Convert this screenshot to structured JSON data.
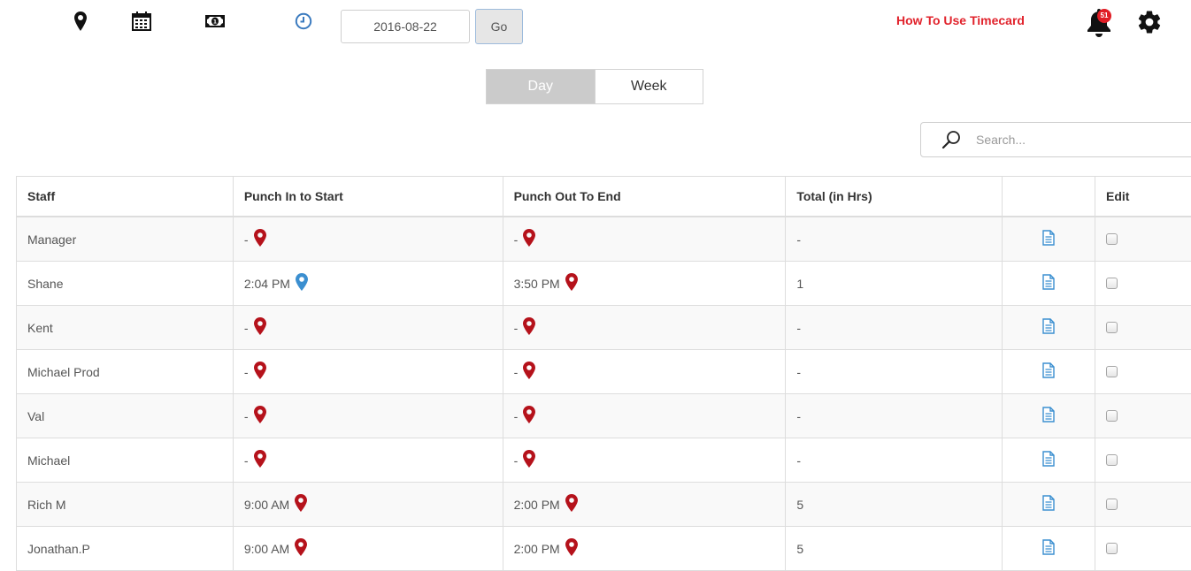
{
  "toolbar": {
    "icons": [
      "location-pin-icon",
      "calendar-icon",
      "money-icon",
      "clock-icon"
    ],
    "date_value": "2016-08-22",
    "go_label": "Go",
    "help_link": "How To Use Timecard",
    "notification_count": "51",
    "settings_icon": "gear-icon"
  },
  "view_toggle": {
    "day_label": "Day",
    "week_label": "Week",
    "active": "Day"
  },
  "search": {
    "placeholder": "Search..."
  },
  "table": {
    "headers": {
      "staff": "Staff",
      "punch_in": "Punch In to Start",
      "punch_out": "Punch Out To End",
      "total": "Total (in Hrs)",
      "report": "",
      "edit": "Edit"
    },
    "rows": [
      {
        "staff": "Manager",
        "punch_in": "-",
        "punch_in_pin": "red",
        "punch_out": "-",
        "punch_out_pin": "red",
        "total": "-"
      },
      {
        "staff": "Shane",
        "punch_in": "2:04 PM",
        "punch_in_pin": "blue",
        "punch_out": "3:50 PM",
        "punch_out_pin": "red",
        "total": "1"
      },
      {
        "staff": "Kent",
        "punch_in": "-",
        "punch_in_pin": "red",
        "punch_out": "-",
        "punch_out_pin": "red",
        "total": "-"
      },
      {
        "staff": "Michael Prod",
        "punch_in": "-",
        "punch_in_pin": "red",
        "punch_out": "-",
        "punch_out_pin": "red",
        "total": "-"
      },
      {
        "staff": "Val",
        "punch_in": "-",
        "punch_in_pin": "red",
        "punch_out": "-",
        "punch_out_pin": "red",
        "total": "-"
      },
      {
        "staff": "Michael",
        "punch_in": "-",
        "punch_in_pin": "red",
        "punch_out": "-",
        "punch_out_pin": "red",
        "total": "-"
      },
      {
        "staff": "Rich M",
        "punch_in": "9:00 AM",
        "punch_in_pin": "red",
        "punch_out": "2:00 PM",
        "punch_out_pin": "red",
        "total": "5"
      },
      {
        "staff": "Jonathan.P",
        "punch_in": "9:00 AM",
        "punch_in_pin": "red",
        "punch_out": "2:00 PM",
        "punch_out_pin": "red",
        "total": "5"
      }
    ]
  },
  "colors": {
    "pin_red": "#b5121b",
    "pin_blue": "#3b8fd0",
    "accent_red": "#e1232c",
    "doc_blue": "#3b8fd0"
  }
}
